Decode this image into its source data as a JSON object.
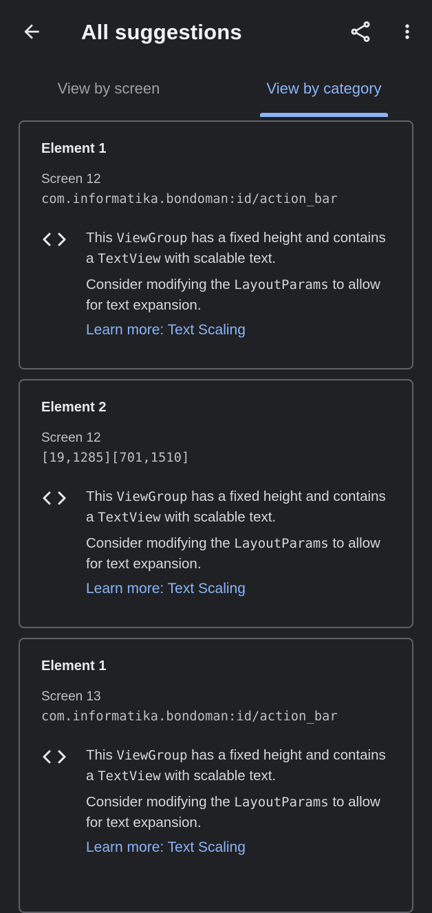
{
  "appbar": {
    "title": "All suggestions",
    "back_icon": "arrow-back-icon",
    "share_icon": "share-icon",
    "more_icon": "more-vert-icon"
  },
  "tabs": [
    {
      "label": "View by screen",
      "selected": false
    },
    {
      "label": "View by category",
      "selected": true
    }
  ],
  "colors": {
    "background": "#202124",
    "accent": "#8ab4f8",
    "card_border": "#5f6368"
  },
  "cards": [
    {
      "title": "Element 1",
      "screen": "Screen 12",
      "resource": "com.informatika.bondoman:id/action_bar",
      "icon": "code-icon",
      "msg1_a": "This ",
      "msg1_code1": "ViewGroup",
      "msg1_b": " has a fixed height and contains a ",
      "msg1_code2": "TextView",
      "msg1_c": " with scalable text.",
      "msg2_a": "Consider modifying the ",
      "msg2_code": "LayoutParams",
      "msg2_b": " to allow for text expansion.",
      "link": "Learn more: Text Scaling"
    },
    {
      "title": "Element 2",
      "screen": "Screen 12",
      "resource": "[19,1285][701,1510]",
      "icon": "code-icon",
      "msg1_a": "This ",
      "msg1_code1": "ViewGroup",
      "msg1_b": " has a fixed height and contains a ",
      "msg1_code2": "TextView",
      "msg1_c": " with scalable text.",
      "msg2_a": "Consider modifying the ",
      "msg2_code": "LayoutParams",
      "msg2_b": " to allow for text expansion.",
      "link": "Learn more: Text Scaling"
    },
    {
      "title": "Element 1",
      "screen": "Screen 13",
      "resource": "com.informatika.bondoman:id/action_bar",
      "icon": "code-icon",
      "msg1_a": "This ",
      "msg1_code1": "ViewGroup",
      "msg1_b": " has a fixed height and contains a ",
      "msg1_code2": "TextView",
      "msg1_c": " with scalable text.",
      "msg2_a": "Consider modifying the ",
      "msg2_code": "LayoutParams",
      "msg2_b": " to allow for text expansion.",
      "link": "Learn more: Text Scaling"
    }
  ]
}
